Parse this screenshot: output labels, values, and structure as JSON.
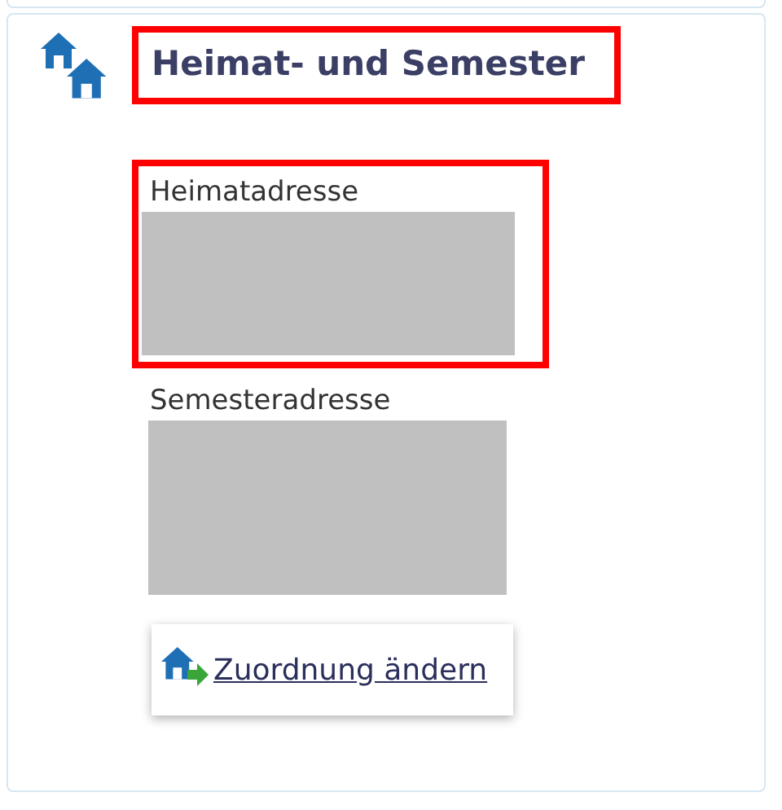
{
  "panel": {
    "title": "Heimat- und Semester",
    "title_highlighted": true
  },
  "addresses": [
    {
      "label": "Heimatadresse",
      "highlighted": true
    },
    {
      "label": "Semesteradresse",
      "highlighted": false
    }
  ],
  "action": {
    "label": "Zuordnung ändern"
  }
}
